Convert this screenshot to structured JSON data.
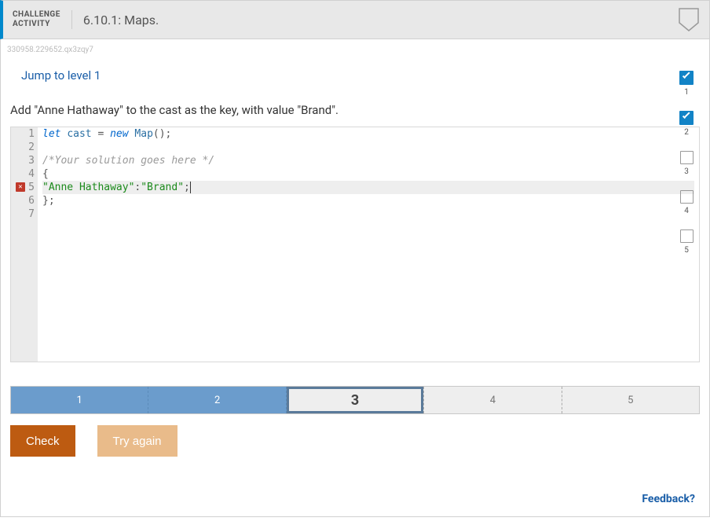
{
  "header": {
    "challenge_label_line1": "CHALLENGE",
    "challenge_label_line2": "ACTIVITY",
    "title": "6.10.1: Maps."
  },
  "hash": "330958.229652.qx3zqy7",
  "jump_link": "Jump to level 1",
  "instruction": "Add \"Anne Hathaway\" to the cast as the key, with value \"Brand\".",
  "code": {
    "lines": [
      {
        "n": "1",
        "tokens": [
          [
            "kw",
            "let"
          ],
          [
            "",
            " "
          ],
          [
            "var",
            "cast"
          ],
          [
            "",
            " "
          ],
          [
            "op",
            "="
          ],
          [
            "",
            " "
          ],
          [
            "kw",
            "new"
          ],
          [
            "",
            " "
          ],
          [
            "var",
            "Map"
          ],
          [
            "op",
            "();"
          ]
        ]
      },
      {
        "n": "2",
        "tokens": []
      },
      {
        "n": "3",
        "tokens": [
          [
            "com",
            "/*Your solution goes here */"
          ]
        ]
      },
      {
        "n": "4",
        "tokens": [
          [
            "op",
            "{"
          ]
        ]
      },
      {
        "n": "5",
        "highlight": true,
        "error": true,
        "tokens": [
          [
            "str",
            "\"Anne Hathaway\""
          ],
          [
            "op",
            ":"
          ],
          [
            "str",
            "\"Brand\""
          ],
          [
            "op",
            ";"
          ]
        ]
      },
      {
        "n": "6",
        "tokens": [
          [
            "op",
            "};"
          ]
        ]
      },
      {
        "n": "7",
        "tokens": []
      }
    ]
  },
  "steps": [
    {
      "n": "1",
      "state": "done"
    },
    {
      "n": "2",
      "state": "done"
    },
    {
      "n": "3",
      "state": "empty"
    },
    {
      "n": "4",
      "state": "empty"
    },
    {
      "n": "5",
      "state": "empty"
    }
  ],
  "levels": [
    {
      "n": "1",
      "state": "done"
    },
    {
      "n": "2",
      "state": "done"
    },
    {
      "n": "3",
      "state": "current"
    },
    {
      "n": "4",
      "state": "pending"
    },
    {
      "n": "5",
      "state": "pending"
    }
  ],
  "buttons": {
    "check": "Check",
    "try_again": "Try again"
  },
  "feedback": "Feedback?"
}
